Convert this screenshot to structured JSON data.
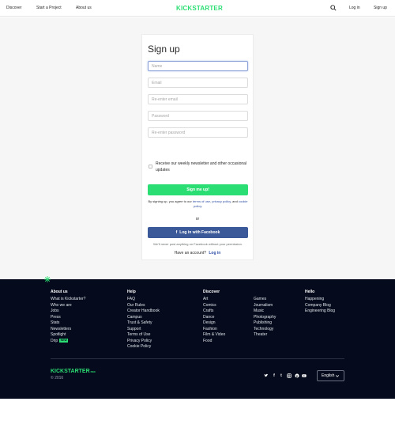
{
  "header": {
    "nav": [
      "Discover",
      "Start a Project",
      "About us"
    ],
    "logo": "KICKSTARTER",
    "login": "Log in",
    "signup": "Sign up",
    "brand_color": "#2bde73"
  },
  "form": {
    "title": "Sign up",
    "fields": [
      {
        "placeholder": "Name",
        "value": ""
      },
      {
        "placeholder": "Email",
        "value": ""
      },
      {
        "placeholder": "Re-enter email",
        "value": ""
      },
      {
        "placeholder": "Password",
        "value": ""
      },
      {
        "placeholder": "Re-enter password",
        "value": ""
      }
    ],
    "newsletter_label": "Receive our weekly newsletter and other occasional updates",
    "newsletter_checked": false,
    "submit": "Sign me up!",
    "terms_prefix": "By signing up, you agree to our",
    "terms_link": "terms of use",
    "terms_sep": ",",
    "privacy_link": "privacy policy",
    "terms_and": ", and",
    "cookie_link": "cookie policy",
    "terms_end": ".",
    "or": "or",
    "facebook": "Log in with Facebook",
    "facebook_note": "We'll never post anything on Facebook without your permission.",
    "have_account": "Have an account?",
    "login_link": "Log in"
  },
  "footer": {
    "about": {
      "title": "About us",
      "items": [
        "What is Kickstarter?",
        "Who we are",
        "Jobs",
        "Press",
        "Stats",
        "Newsletters",
        "Spotlight",
        "Drip"
      ],
      "drip_badge": "NEW"
    },
    "help": {
      "title": "Help",
      "items": [
        "FAQ",
        "Our Rules",
        "Creator Handbook",
        "Campus",
        "Trust & Safety",
        "Support",
        "Terms of Use",
        "Privacy Policy",
        "Cookie Policy"
      ]
    },
    "discover": {
      "title": "Discover",
      "col1": [
        "Art",
        "Comics",
        "Crafts",
        "Dance",
        "Design",
        "Fashion",
        "Film & Video",
        "Food"
      ],
      "col2": [
        "Games",
        "Journalism",
        "Music",
        "Photography",
        "Publishing",
        "Technology",
        "Theater"
      ]
    },
    "hello": {
      "title": "Hello",
      "items": [
        "Happening",
        "Company Blog",
        "Engineering Blog"
      ]
    },
    "logo": "KICKSTARTER",
    "logo_suffix": "PBC",
    "copyright": "© 2016",
    "social_icons": [
      "twitter-icon",
      "facebook-icon",
      "tumblr-icon",
      "instagram-icon",
      "pinterest-icon",
      "youtube-icon"
    ],
    "language": "English"
  }
}
